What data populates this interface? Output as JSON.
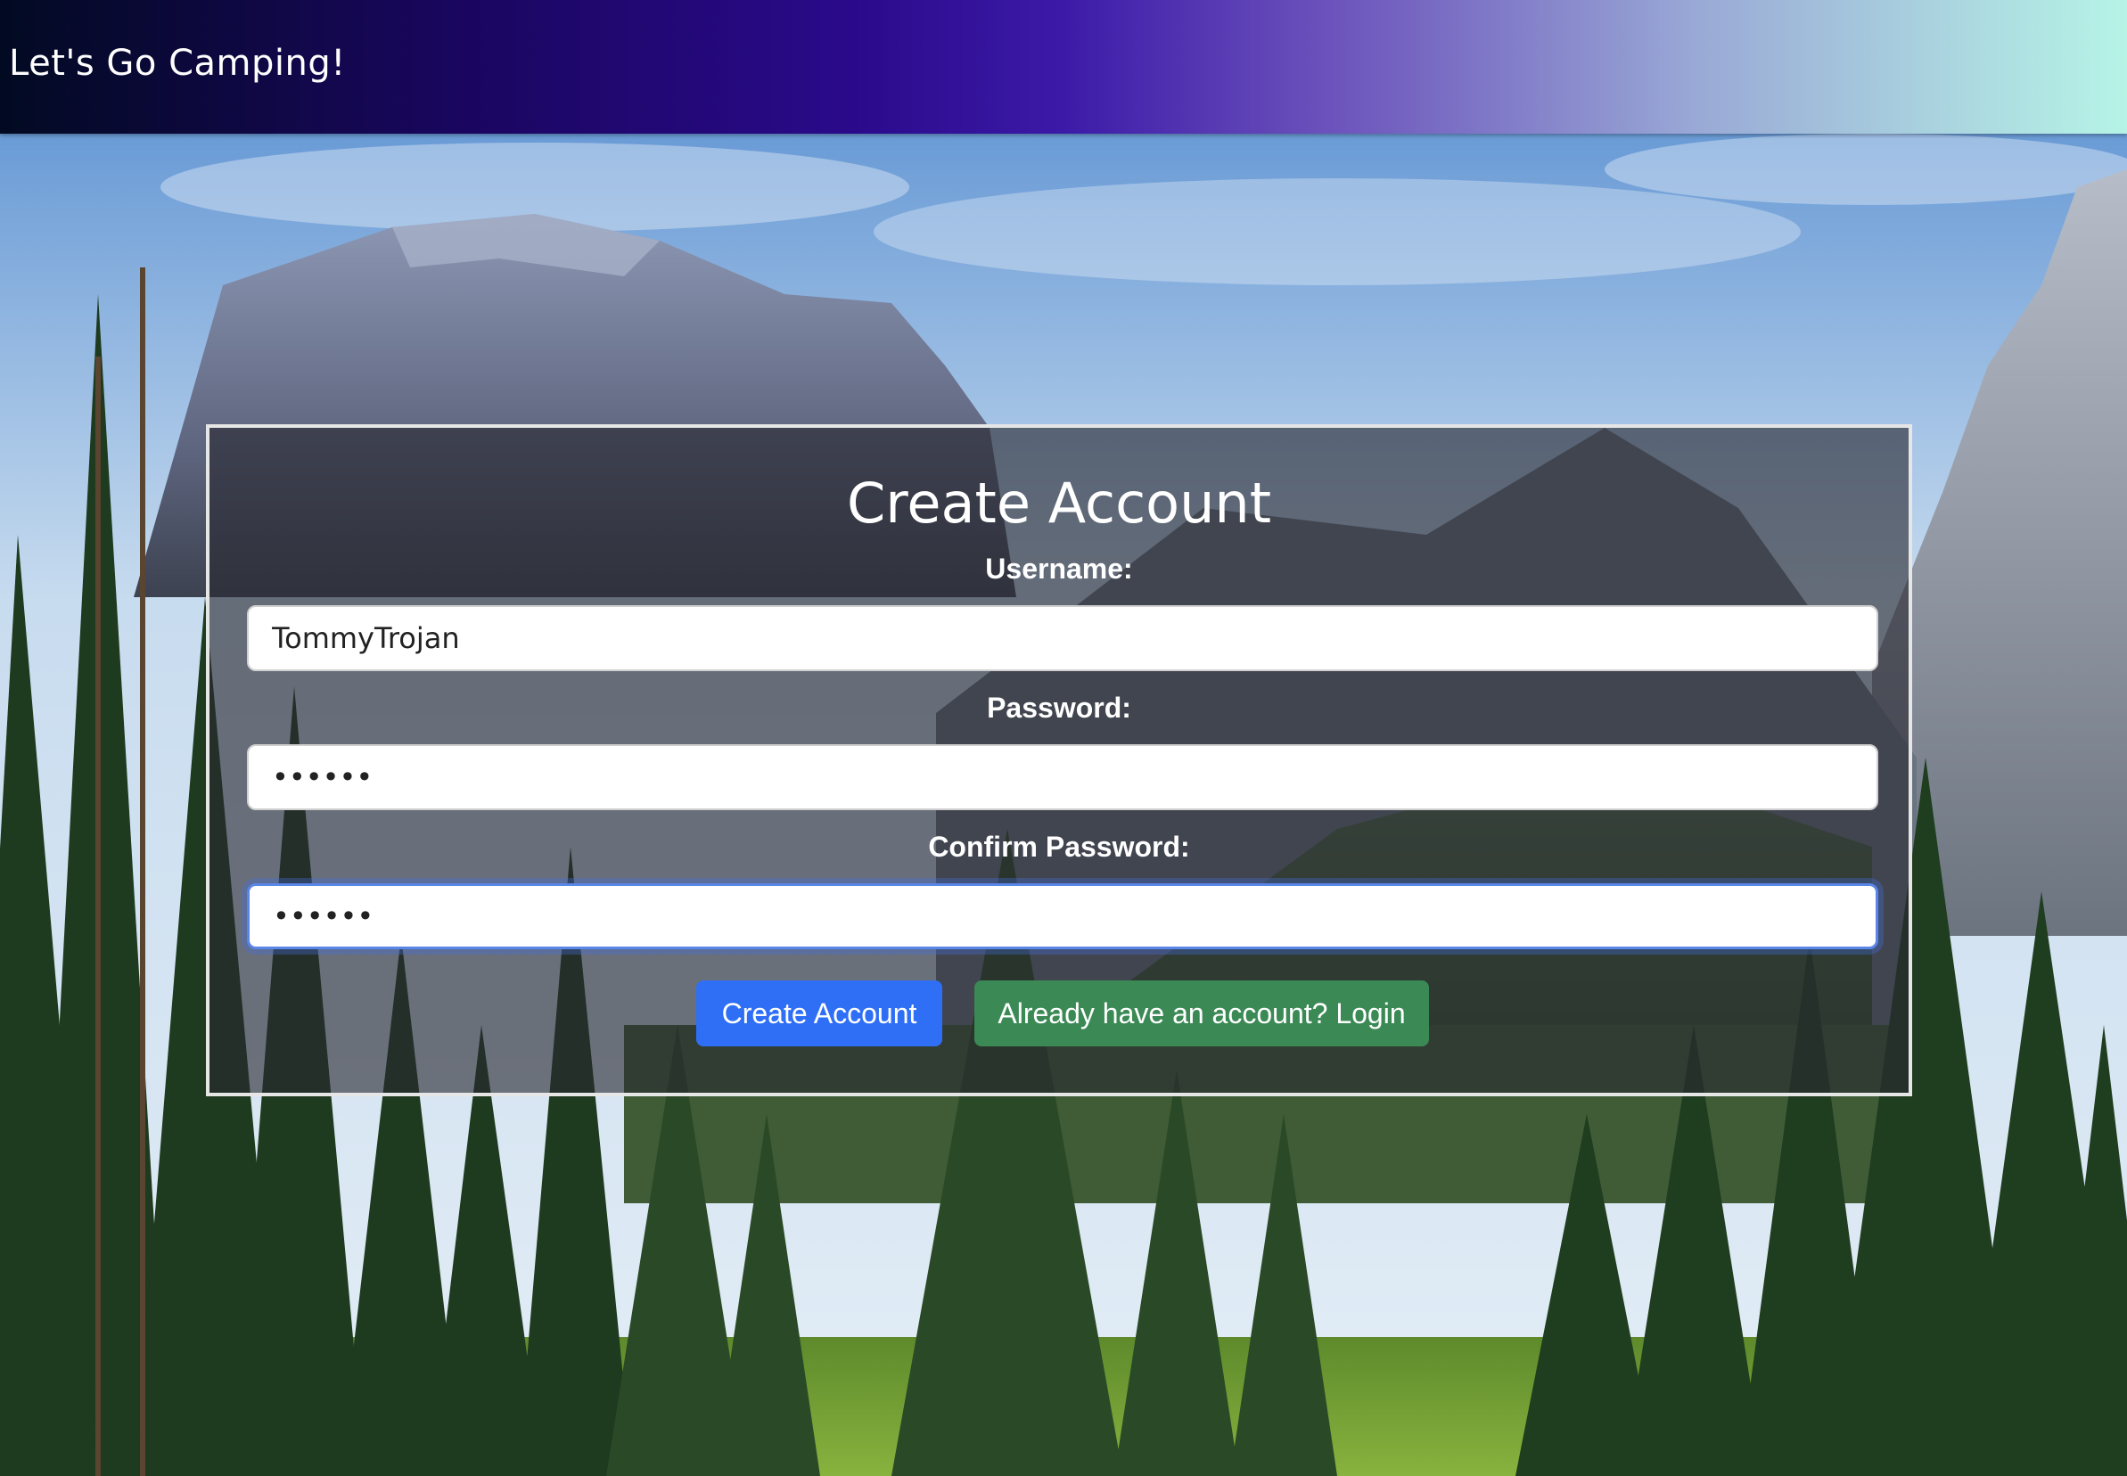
{
  "header": {
    "title": "Let's Go Camping!",
    "gradient_colors": [
      "#020a22",
      "#2a0a8a",
      "#6a50bb",
      "#b6f4e6"
    ]
  },
  "background": {
    "description_icon": "mountain-forest-scene"
  },
  "form": {
    "title": "Create Account",
    "username": {
      "label": "Username:",
      "value": "TommyTrojan"
    },
    "password": {
      "label": "Password:",
      "value": "••••••"
    },
    "confirm_password": {
      "label": "Confirm Password:",
      "value": "••••••"
    },
    "create_button": "Create Account",
    "login_button": "Already have an account? Login"
  },
  "colors": {
    "primary_button": "#2f6ff5",
    "success_button": "#3b8a55",
    "panel_overlay": "rgba(40,40,48,0.62)"
  }
}
